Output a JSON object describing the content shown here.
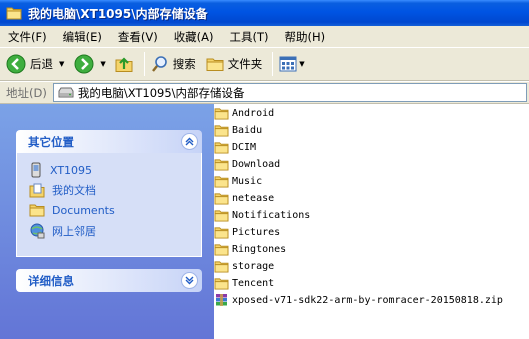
{
  "window": {
    "title": "我的电脑\\XT1095\\内部存储设备"
  },
  "menu": [
    {
      "label": "文件(F)",
      "name": "menu-file"
    },
    {
      "label": "编辑(E)",
      "name": "menu-edit"
    },
    {
      "label": "查看(V)",
      "name": "menu-view"
    },
    {
      "label": "收藏(A)",
      "name": "menu-favorites"
    },
    {
      "label": "工具(T)",
      "name": "menu-tools"
    },
    {
      "label": "帮助(H)",
      "name": "menu-help"
    }
  ],
  "toolbar": {
    "back_label": "后退",
    "search_label": "搜索",
    "folders_label": "文件夹"
  },
  "address": {
    "label": "地址(D)",
    "value": "我的电脑\\XT1095\\内部存储设备"
  },
  "other_places": {
    "title": "其它位置",
    "items": [
      {
        "label": "XT1095",
        "icon": "phone-icon"
      },
      {
        "label": "我的文档",
        "icon": "my-documents-icon"
      },
      {
        "label": "Documents",
        "icon": "folder-icon"
      },
      {
        "label": "网上邻居",
        "icon": "network-icon"
      }
    ]
  },
  "details": {
    "title": "详细信息"
  },
  "files": [
    {
      "name": "Android",
      "type": "folder"
    },
    {
      "name": "Baidu",
      "type": "folder"
    },
    {
      "name": "DCIM",
      "type": "folder"
    },
    {
      "name": "Download",
      "type": "folder"
    },
    {
      "name": "Music",
      "type": "folder"
    },
    {
      "name": "netease",
      "type": "folder"
    },
    {
      "name": "Notifications",
      "type": "folder"
    },
    {
      "name": "Pictures",
      "type": "folder"
    },
    {
      "name": "Ringtones",
      "type": "folder"
    },
    {
      "name": "storage",
      "type": "folder"
    },
    {
      "name": "Tencent",
      "type": "folder"
    },
    {
      "name": "xposed-v71-sdk22-arm-by-romracer-20150818.zip",
      "type": "zip"
    }
  ],
  "colors": {
    "titlebar": "#0054e3",
    "taskpane": "#6d8ce0",
    "panel_title": "#215dc6",
    "folder": "#f5d46a"
  }
}
